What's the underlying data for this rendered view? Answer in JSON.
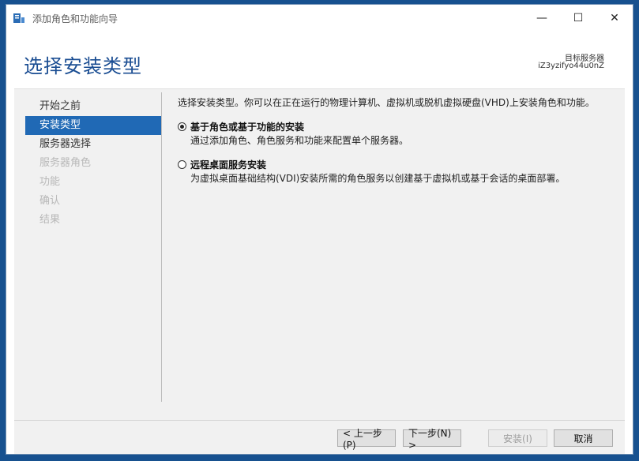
{
  "window": {
    "title": "添加角色和功能向导",
    "controls": {
      "minimize": "—",
      "maximize": "☐",
      "close": "✕"
    }
  },
  "header": {
    "page_title": "选择安装类型",
    "target_label": "目标服务器",
    "target_server": "iZ3yzifyo44u0nZ"
  },
  "nav": {
    "items": [
      {
        "label": "开始之前",
        "state": "normal"
      },
      {
        "label": "安装类型",
        "state": "active"
      },
      {
        "label": "服务器选择",
        "state": "normal"
      },
      {
        "label": "服务器角色",
        "state": "disabled"
      },
      {
        "label": "功能",
        "state": "disabled"
      },
      {
        "label": "确认",
        "state": "disabled"
      },
      {
        "label": "结果",
        "state": "disabled"
      }
    ]
  },
  "content": {
    "intro": "选择安装类型。你可以在正在运行的物理计算机、虚拟机或脱机虚拟硬盘(VHD)上安装角色和功能。",
    "options": [
      {
        "title": "基于角色或基于功能的安装",
        "desc": "通过添加角色、角色服务和功能来配置单个服务器。",
        "selected": true
      },
      {
        "title": "远程桌面服务安装",
        "desc": "为虚拟桌面基础结构(VDI)安装所需的角色服务以创建基于虚拟机或基于会话的桌面部署。",
        "selected": false
      }
    ]
  },
  "footer": {
    "prev": "< 上一步(P)",
    "next": "下一步(N) >",
    "install": "安装(I)",
    "cancel": "取消"
  },
  "icons": {
    "app_icon": "server-manager-icon",
    "radio_checked": "radio-checked-icon"
  }
}
